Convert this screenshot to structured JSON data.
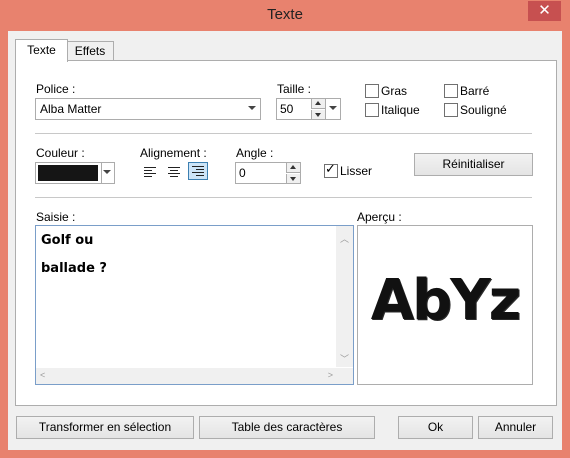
{
  "window": {
    "title": "Texte",
    "close_glyph": "✕"
  },
  "tabs": [
    {
      "label": "Texte"
    },
    {
      "label": "Effets"
    }
  ],
  "font": {
    "label": "Police :",
    "value": "Alba Matter"
  },
  "size": {
    "label": "Taille :",
    "value": "50"
  },
  "styles": {
    "bold": "Gras",
    "italic": "Italique",
    "strike": "Barré",
    "underline": "Souligné"
  },
  "color": {
    "label": "Couleur :",
    "swatch": "#151515"
  },
  "alignment": {
    "label": "Alignement :",
    "selected": "right"
  },
  "angle": {
    "label": "Angle :",
    "value": "0"
  },
  "smooth": {
    "label": "Lisser",
    "checked": true
  },
  "reset_label": "Réinitialiser",
  "input": {
    "label": "Saisie :",
    "lines": [
      "Golf ou",
      "ballade ?"
    ]
  },
  "preview": {
    "label": "Aperçu :",
    "text": "AbYz"
  },
  "footer": {
    "to_selection": "Transformer en sélection",
    "char_table": "Table des caractères",
    "ok": "Ok",
    "cancel": "Annuler"
  }
}
